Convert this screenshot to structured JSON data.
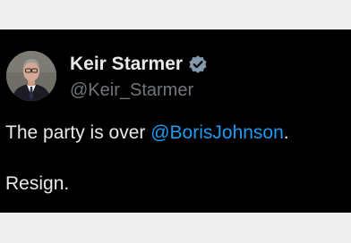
{
  "author": {
    "display_name": "Keir Starmer",
    "handle": "@Keir_Starmer",
    "verified": true
  },
  "tweet": {
    "line1_text": "The party is over ",
    "line1_mention": "@BorisJohnson",
    "line1_end": ".",
    "line2_text": "Resign."
  },
  "colors": {
    "background": "#000000",
    "text": "#e7e9ea",
    "handle": "#71767b",
    "mention": "#1d9bf0",
    "badge": "#829aab"
  },
  "icons": {
    "avatar": "profile-photo",
    "badge": "verified-badge-icon"
  }
}
